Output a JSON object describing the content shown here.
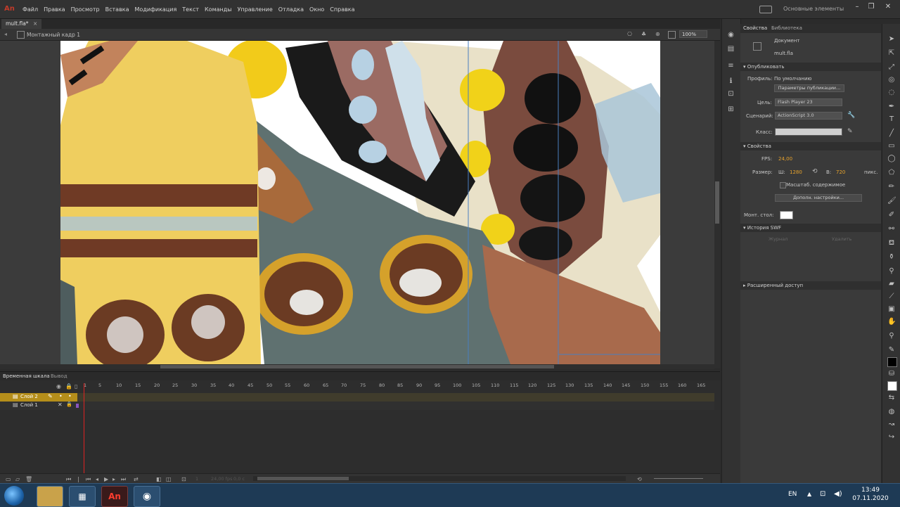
{
  "app": {
    "logo": "An",
    "workspace": "Основные элементы"
  },
  "menu": [
    "Файл",
    "Правка",
    "Просмотр",
    "Вставка",
    "Модификация",
    "Текст",
    "Команды",
    "Управление",
    "Отладка",
    "Окно",
    "Справка"
  ],
  "document": {
    "tab_label": "mult.fla*",
    "tab_close": "×",
    "scene": "Монтажный кадр 1",
    "zoom": "100%"
  },
  "properties": {
    "tabs": [
      "Свойства",
      "Библиотека"
    ],
    "doc_label": "Документ",
    "doc_name": "mult.fla",
    "publish": {
      "section": "Опубликовать",
      "profile_label": "Профиль:",
      "profile_value": "По умолчанию",
      "publish_settings_button": "Параметры публикации...",
      "target_label": "Цель:",
      "target_value": "Flash Player 23",
      "script_label": "Сценарий:",
      "script_value": "ActionScript 3.0",
      "class_label": "Класс:"
    },
    "props": {
      "section": "Свойства",
      "fps_label": "FPS:",
      "fps_value": "24,00",
      "size_label": "Размер:",
      "w_label": "Ш:",
      "w_value": "1280",
      "h_label": "В:",
      "h_value": "720",
      "unit": "пикс.",
      "scale_content": "Масштаб. содержимое",
      "advanced_button": "Дополн. настройки...",
      "stage_label": "Монт. стол:",
      "stage_color": "#ffffff"
    },
    "swf_history": {
      "section": "История SWF",
      "log_button": "Журнал",
      "clear_button": "Удалить"
    },
    "extended_access": "Расширенный доступ"
  },
  "timeline": {
    "tabs": [
      "Временная шкала",
      "Вывод"
    ],
    "frame_numbers": [
      "1",
      "5",
      "10",
      "15",
      "20",
      "25",
      "30",
      "35",
      "40",
      "45",
      "50",
      "55",
      "60",
      "65",
      "70",
      "75",
      "80",
      "85",
      "90",
      "95",
      "100",
      "105",
      "110",
      "115",
      "120",
      "125",
      "130",
      "135",
      "140",
      "145",
      "150",
      "155",
      "160",
      "165"
    ],
    "layers": [
      {
        "name": "Слой 2"
      },
      {
        "name": "Слой 1"
      }
    ],
    "fps_readout": "24,00 fps",
    "time_readout": "0,0 с"
  },
  "taskbar": {
    "lang": "EN",
    "time": "13:49",
    "date": "07.11.2020"
  },
  "colors": {
    "accent": "#b58e1a",
    "stage_bg": "#3b3b3b",
    "playhead": "#dd2222"
  }
}
